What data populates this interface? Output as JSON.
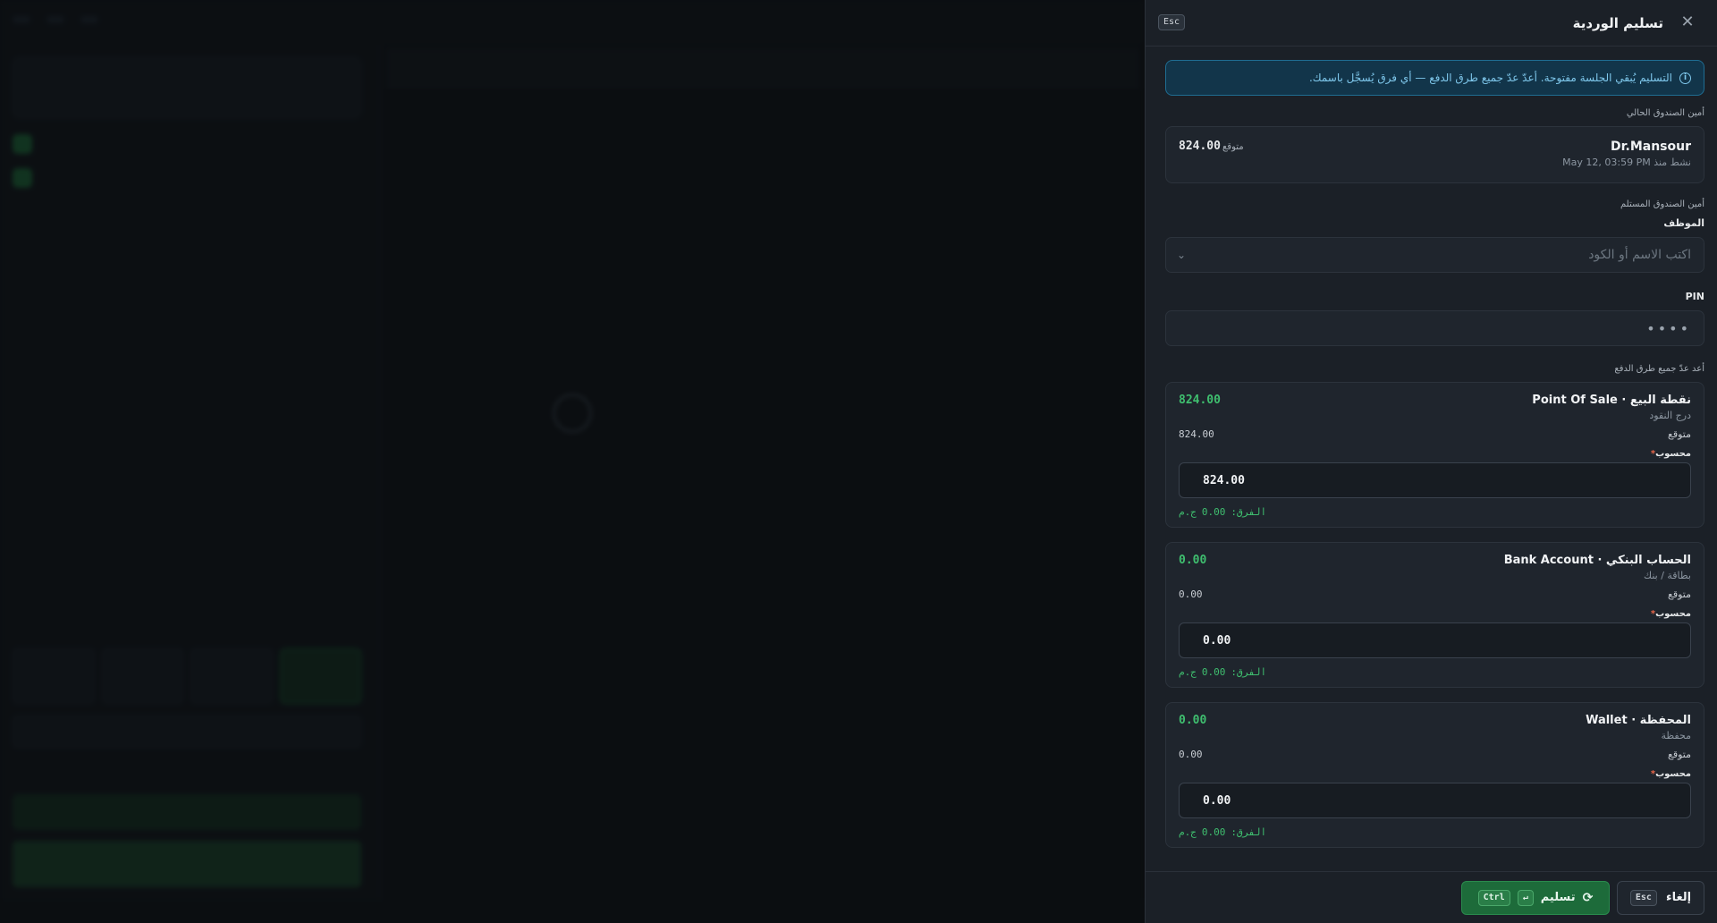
{
  "drawer": {
    "title": "تسليم الوردية",
    "esc_key": "Esc",
    "close_glyph": "✕",
    "alert": "التسليم يُبقي الجلسة مفتوحة. أعدّ عدّ جميع طرق الدفع — أي فرق يُسجَّل باسمك.",
    "current_cashier_label": "أمين الصندوق الحالي",
    "current_cashier": {
      "name": "Dr.Mansour",
      "since": "نشط منذ May 12, 03:59 PM",
      "expected_label": "متوقع",
      "expected_value": "824.00"
    },
    "receiving_label": "أمين الصندوق المستلم",
    "employee_label": "الموظف",
    "employee_placeholder": "اكتب الاسم أو الكود",
    "pin_label": "PIN",
    "pin_value": "••••",
    "count_label": "أعد عدّ جميع طرق الدفع",
    "methods": [
      {
        "name": "نقطة البيع · Point Of Sale",
        "sub": "درج النقود",
        "amount": "824.00",
        "expected_label": "متوقع",
        "expected_value": "824.00",
        "counted_label": "محسوب",
        "counted_value": "824.00",
        "diff_label": "الفرق:",
        "diff_value": "0.00",
        "diff_unit": "ج.م"
      },
      {
        "name": "الحساب البنكي · Bank Account",
        "sub": "بطاقة / بنك",
        "amount": "0.00",
        "expected_label": "متوقع",
        "expected_value": "0.00",
        "counted_label": "محسوب",
        "counted_value": "0.00",
        "diff_label": "الفرق:",
        "diff_value": "0.00",
        "diff_unit": "ج.م"
      },
      {
        "name": "المحفظة · Wallet",
        "sub": "محفظة",
        "amount": "0.00",
        "expected_label": "متوقع",
        "expected_value": "0.00",
        "counted_label": "محسوب",
        "counted_value": "0.00",
        "diff_label": "الفرق:",
        "diff_value": "0.00",
        "diff_unit": "ج.م"
      }
    ],
    "footer": {
      "cancel_label": "إلغاء",
      "cancel_key": "Esc",
      "submit_label": "تسليم",
      "submit_key1": "Ctrl",
      "submit_key2": "↵"
    }
  },
  "colors": {
    "accent_green": "#3fbf6f",
    "submit_green": "#1d6b3a",
    "info_blue": "#12354a"
  }
}
